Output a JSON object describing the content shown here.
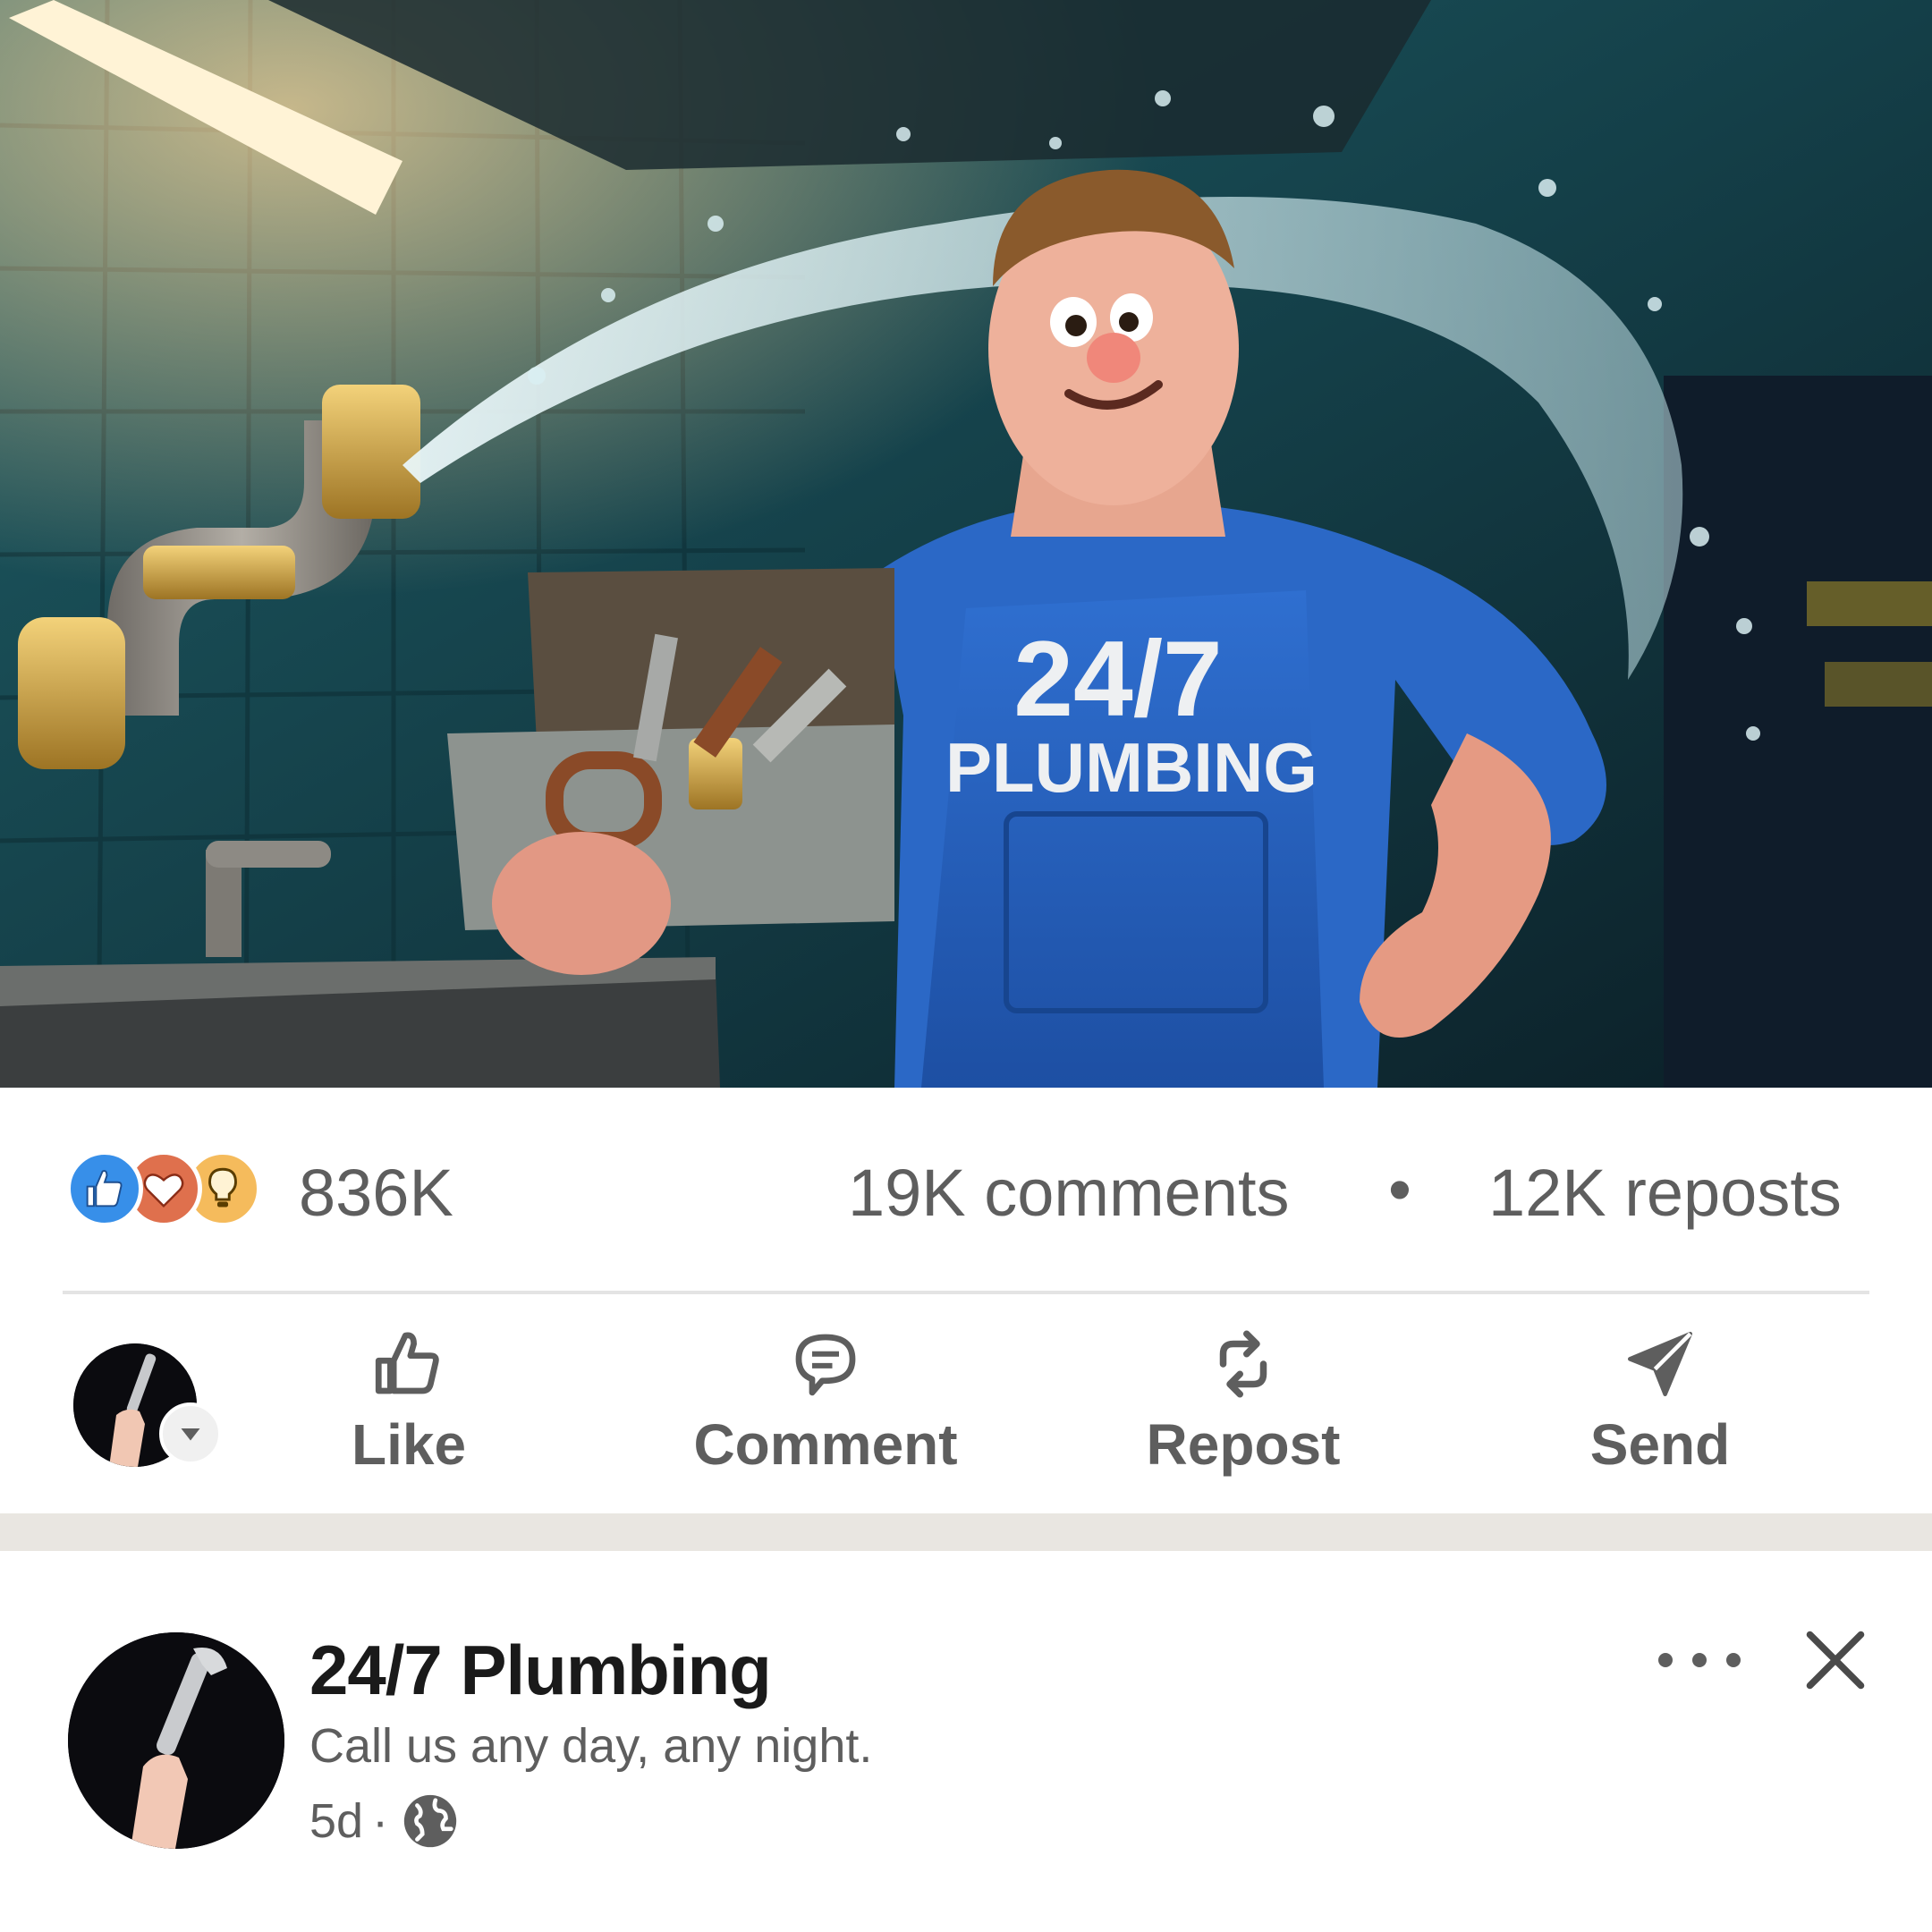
{
  "post": {
    "image_alt": "Cartoon plumber in blue overalls holding a toolbox while a pipe bursts behind him",
    "overall_text_line1": "24/7",
    "overall_text_line2": "PLUMBING",
    "reaction_icons": [
      "like-icon",
      "love-icon",
      "insightful-icon"
    ],
    "reactions_count": "836K",
    "comments_count": "19K comments",
    "separator": "•",
    "reposts_count": "12K reposts"
  },
  "actions": {
    "like": "Like",
    "comment": "Comment",
    "repost": "Repost",
    "send": "Send"
  },
  "next_post": {
    "author_name": "24/7 Plumbing",
    "tagline": "Call us any day, any night.",
    "age": "5d",
    "meta_separator": "·",
    "visibility_icon": "globe-icon",
    "more_icon": "more-icon",
    "close_icon": "close-icon"
  },
  "colors": {
    "accent_like": "#378fe9",
    "accent_love": "#df704d",
    "accent_insight": "#f5bb5c",
    "muted_text": "#5e5e5e",
    "feed_gap": "#e9e6e1"
  }
}
